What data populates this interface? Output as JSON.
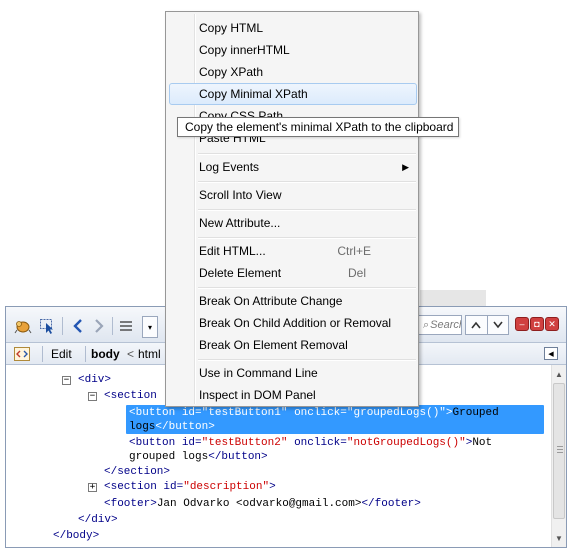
{
  "context_menu": {
    "items": [
      {
        "label": "Copy HTML"
      },
      {
        "label": "Copy innerHTML"
      },
      {
        "label": "Copy XPath"
      },
      {
        "label": "Copy Minimal XPath"
      },
      {
        "label": "Copy CSS Path"
      },
      {
        "label": "Paste HTML"
      },
      {
        "label": "Log Events"
      },
      {
        "label": "Scroll Into View"
      },
      {
        "label": "New Attribute..."
      },
      {
        "label": "Edit HTML...",
        "shortcut": "Ctrl+E"
      },
      {
        "label": "Delete Element",
        "shortcut": "Del"
      },
      {
        "label": "Break On Attribute Change"
      },
      {
        "label": "Break On Child Addition or Removal"
      },
      {
        "label": "Break On Element Removal"
      },
      {
        "label": "Use in Command Line"
      },
      {
        "label": "Inspect in DOM Panel"
      }
    ],
    "hovered_item": "Copy Minimal XPath"
  },
  "tooltip": "Copy the element's minimal XPath to the clipboard",
  "toolbar": {
    "search_placeholder": "Search"
  },
  "breadcrumbs": {
    "edit_label": "Edit",
    "current": "body",
    "separator": "<",
    "parent": "html"
  },
  "tree": {
    "div_open": "<div>",
    "section_open": "<section",
    "button1_line1": {
      "tag_open": "<button",
      "id_attr": "id=",
      "id_val": "\"testButton1\"",
      "onclick_attr": "onclick=",
      "onclick_val": "\"groupedLogs()\"",
      "close": ">",
      "text": "Grouped"
    },
    "button1_line2": {
      "text": "logs",
      "close_tag": "</button>"
    },
    "button2_line1": {
      "tag_open": "<button",
      "id_attr": "id=",
      "id_val": "\"testButton2\"",
      "onclick_attr": "onclick=",
      "onclick_val": "\"notGroupedLogs()\"",
      "close": ">",
      "text": "Not"
    },
    "button2_line2": {
      "text": "grouped logs",
      "close_tag": "</button>"
    },
    "section_close": "</section>",
    "section2": {
      "tag_open": "<section",
      "id_attr": "id=",
      "id_val": "\"description\"",
      "close": ">"
    },
    "footer": {
      "open": "<footer>",
      "text": "Jan Odvarko <odvarko@gmail.com>",
      "close": "</footer>"
    },
    "div_close": "</div>",
    "body_close": "</body>"
  },
  "colors": {
    "selection": "#3399ff",
    "tag": "#000088",
    "attr_value": "#cc0000",
    "menu_hover_border": "#a8cbf0"
  }
}
